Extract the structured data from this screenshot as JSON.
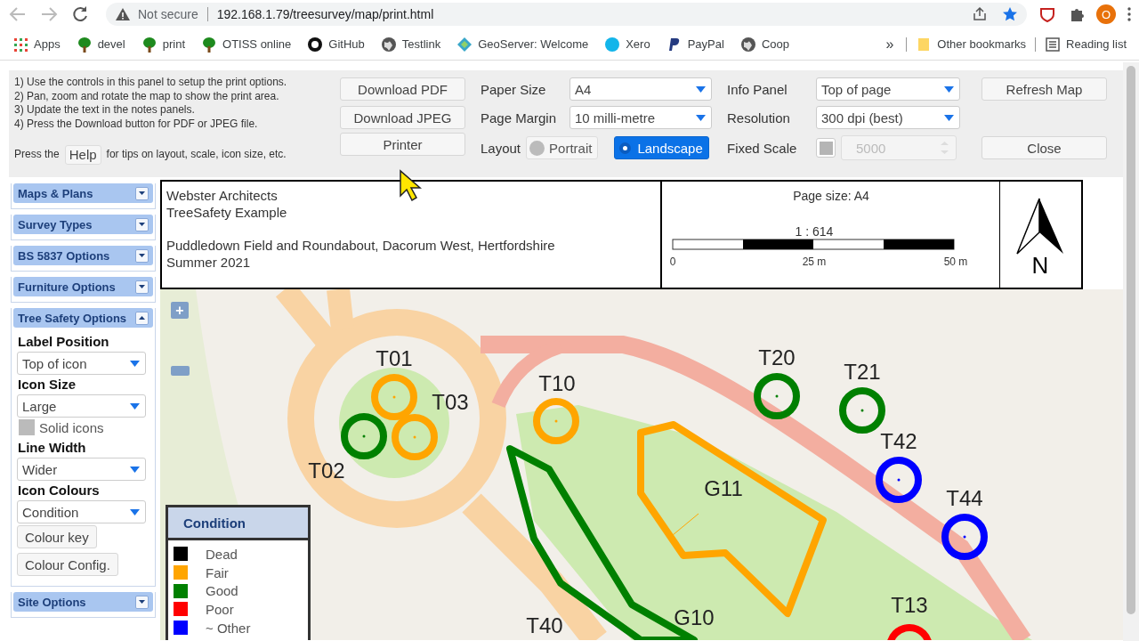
{
  "browser": {
    "security": "Not secure",
    "url": "192.168.1.79/treesurvey/map/print.html",
    "profile_initial": "O"
  },
  "bookmarks": [
    {
      "label": "Apps",
      "kind": "apps"
    },
    {
      "label": "devel",
      "kind": "tree"
    },
    {
      "label": "print",
      "kind": "tree"
    },
    {
      "label": "OTISS online",
      "kind": "tree"
    },
    {
      "label": "GitHub",
      "kind": "github"
    },
    {
      "label": "Testlink",
      "kind": "globe"
    },
    {
      "label": "GeoServer: Welcome",
      "kind": "geoserver"
    },
    {
      "label": "Xero",
      "kind": "xero"
    },
    {
      "label": "PayPal",
      "kind": "paypal"
    },
    {
      "label": "Coop",
      "kind": "globe"
    }
  ],
  "bookmarks_overflow": "»",
  "other_bookmarks": "Other bookmarks",
  "reading_list": "Reading list",
  "instructions": [
    "1) Use the controls in this panel to setup the print options.",
    "2) Pan, zoom and rotate the map to show the print area.",
    "3) Update the text in the notes panels.",
    "4) Press the Download button for PDF or JPEG file."
  ],
  "help_line": {
    "before": "Press the",
    "button": "Help",
    "after": "for tips on layout, scale, icon size, etc."
  },
  "action_buttons": [
    "Download PDF",
    "Download JPEG",
    "Printer"
  ],
  "paper_size": {
    "label": "Paper Size",
    "value": "A4"
  },
  "page_margin": {
    "label": "Page Margin",
    "value": "10 milli-metre"
  },
  "layout": {
    "label": "Layout",
    "options": [
      {
        "label": "Portrait",
        "selected": false
      },
      {
        "label": "Landscape",
        "selected": true
      }
    ]
  },
  "info_panel": {
    "label": "Info Panel",
    "value": "Top of page"
  },
  "resolution": {
    "label": "Resolution",
    "value": "300 dpi (best)"
  },
  "fixed_scale": {
    "label": "Fixed Scale",
    "checked": false,
    "value": "5000",
    "disabled": true
  },
  "side_buttons": [
    "Refresh Map",
    "Close"
  ],
  "sidebar": [
    {
      "title": "Maps & Plans",
      "expanded": false
    },
    {
      "title": "Survey Types",
      "expanded": false
    },
    {
      "title": "BS 5837 Options",
      "expanded": false
    },
    {
      "title": "Furniture Options",
      "expanded": false
    },
    {
      "title": "Tree Safety Options",
      "expanded": true,
      "controls": [
        {
          "kind": "heading",
          "text": "Label Position"
        },
        {
          "kind": "select",
          "text": "Top of icon"
        },
        {
          "kind": "heading",
          "text": "Icon Size"
        },
        {
          "kind": "select",
          "text": "Large"
        },
        {
          "kind": "checkbox",
          "text": "Solid icons",
          "checked": false
        },
        {
          "kind": "heading",
          "text": "Line Width"
        },
        {
          "kind": "select",
          "text": "Wider"
        },
        {
          "kind": "heading",
          "text": "Icon Colours"
        },
        {
          "kind": "select",
          "text": "Condition"
        },
        {
          "kind": "button",
          "text": "Colour key"
        },
        {
          "kind": "button",
          "text": "Colour Config."
        }
      ]
    },
    {
      "title": "Site Options",
      "expanded": false
    }
  ],
  "info_box": {
    "title_lines": [
      "Webster Architects",
      "TreeSafety Example"
    ],
    "site_lines": [
      "Puddledown Field and Roundabout, Dacorum West, Hertfordshire",
      "Summer 2021"
    ]
  },
  "scale_box": {
    "page_size": "Page size: A4",
    "ratio": "1 : 614",
    "ticks": [
      "0",
      "25 m",
      "50 m"
    ]
  },
  "north_label": "N",
  "map": {
    "zoom_in": "+",
    "trees": [
      {
        "label": "T01",
        "color": "#ffa500"
      },
      {
        "label": "T03",
        "color": "#ffa500"
      },
      {
        "label": "T02",
        "color": "#008000"
      },
      {
        "label": "T10",
        "color": "#ffa500"
      },
      {
        "label": "T20",
        "color": "#008000"
      },
      {
        "label": "T21",
        "color": "#008000"
      },
      {
        "label": "T42",
        "color": "#0000ff"
      },
      {
        "label": "T44",
        "color": "#0000ff"
      },
      {
        "label": "T13",
        "color": "#ff0000"
      },
      {
        "label": "T40"
      }
    ],
    "groups": [
      {
        "label": "G11",
        "color": "#ffa500"
      },
      {
        "label": "G10",
        "color": "#008000"
      }
    ],
    "legend": {
      "title": "Condition",
      "items": [
        {
          "label": "Dead",
          "color": "#000000"
        },
        {
          "label": "Fair",
          "color": "#ffa500"
        },
        {
          "label": "Good",
          "color": "#008000"
        },
        {
          "label": "Poor",
          "color": "#ff0000"
        },
        {
          "label": "~ Other",
          "color": "#0000ff"
        }
      ]
    }
  }
}
